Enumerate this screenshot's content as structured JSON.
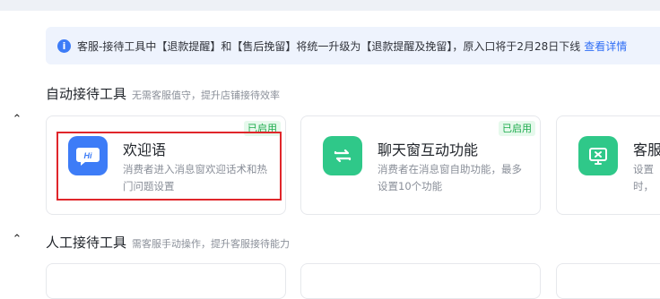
{
  "notice": {
    "text": "客服-接待工具中【退款提醒】和【售后挽留】将统一升级为【退款提醒及挽留】，原入口将于2月28日下线",
    "link": "查看详情"
  },
  "sections": [
    {
      "title": "自动接待工具",
      "subtitle": "无需客服值守，提升店铺接待效率"
    },
    {
      "title": "人工接待工具",
      "subtitle": "需客服手动操作，提升客服接待能力"
    }
  ],
  "cards": [
    {
      "title": "欢迎语",
      "desc": "消费者进入消息窗欢迎话术和热门问题设置",
      "badge": "已启用",
      "icon": "hi-chat-icon",
      "icon_label": "Hi"
    },
    {
      "title": "聊天窗互动功能",
      "desc": "消费者在消息窗自助功能，最多设置10个功能",
      "badge": "已启用",
      "icon": "swap-arrows-icon"
    },
    {
      "title": "客服",
      "desc": "设置 时，",
      "icon": "screen-icon"
    }
  ],
  "colors": {
    "accent": "#3d7cf7",
    "green": "#2fc889",
    "badge_text": "#1dab4d",
    "highlight": "#e0262b"
  }
}
